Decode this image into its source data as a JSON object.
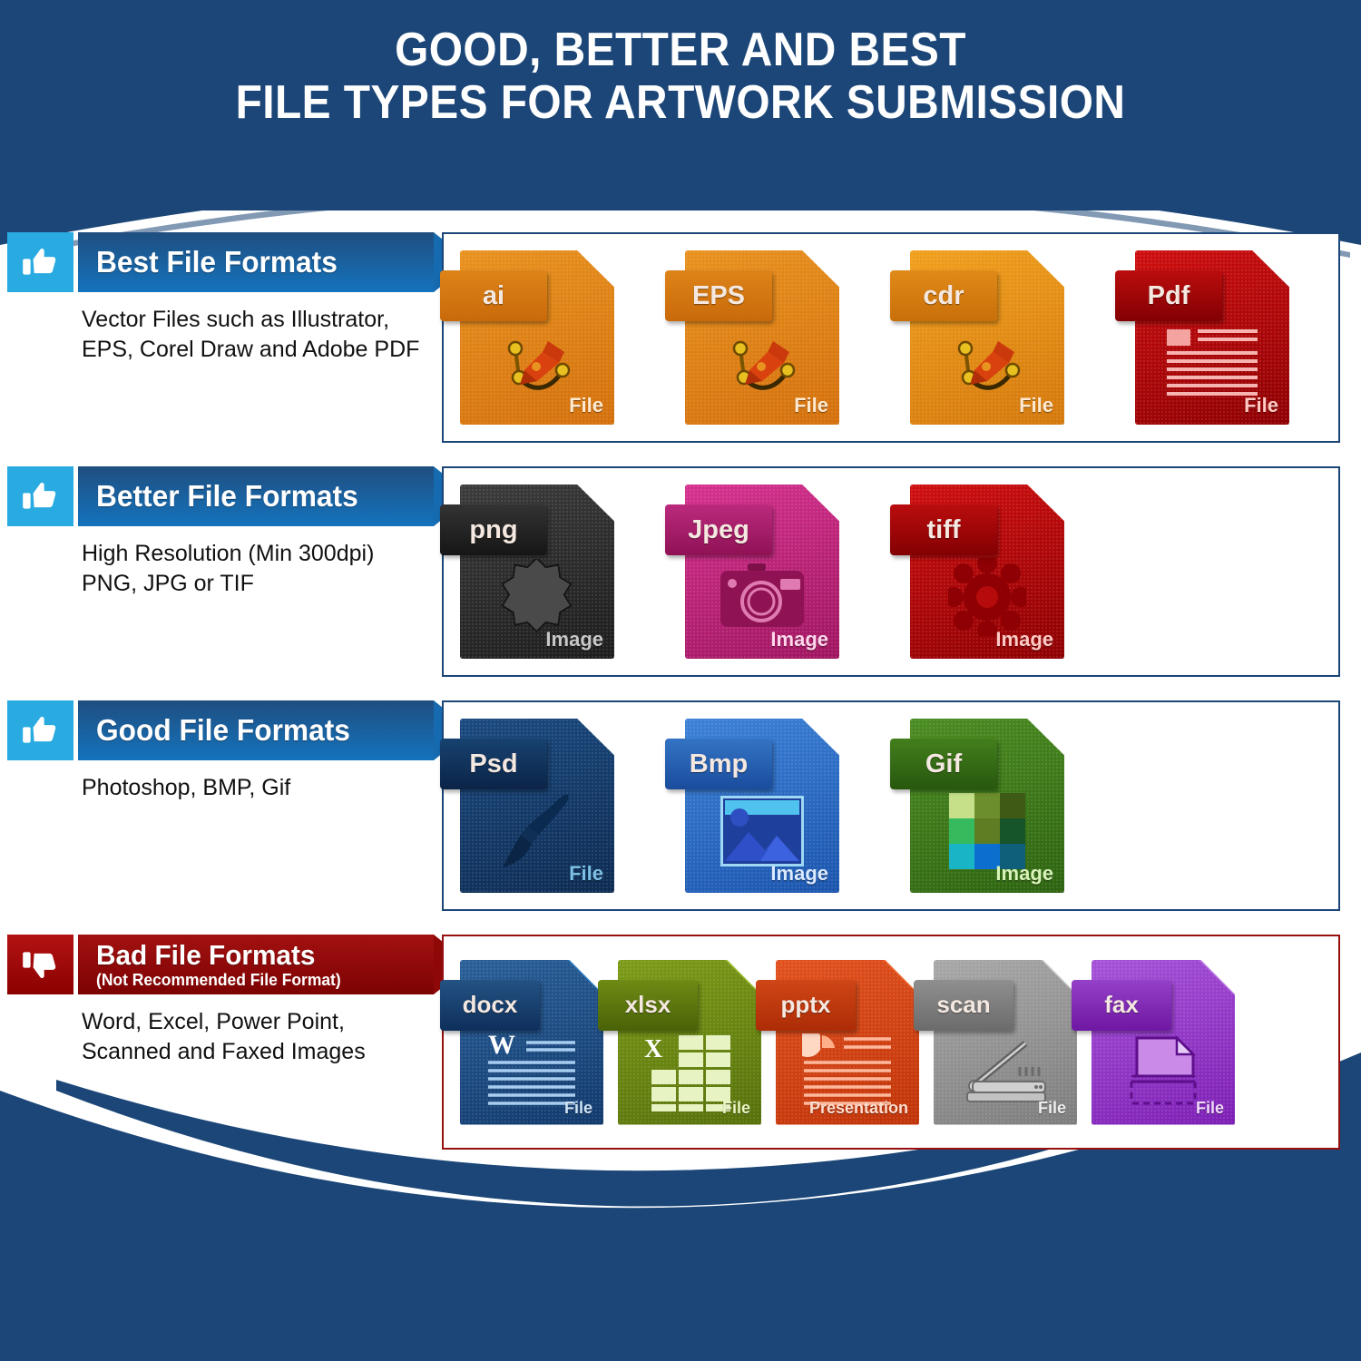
{
  "header": {
    "title_line1": "GOOD, BETTER AND BEST",
    "title_line2": "FILE TYPES FOR ARTWORK SUBMISSION"
  },
  "colors": {
    "brand_navy": "#1b4677",
    "accent_blue": "#29abe2",
    "banner_blue": "#166ab0",
    "bad_red": "#96100f"
  },
  "sections": [
    {
      "id": "best",
      "icon": "thumbs-up-icon",
      "title": "Best File Formats",
      "subtitle": "",
      "description_line1": "Vector Files such as Illustrator,",
      "description_line2": "EPS, Corel Draw and Adobe PDF",
      "files": [
        {
          "label": "ai",
          "kind": "File",
          "glyph": "pen-tool-icon",
          "page_top": "#e8921f",
          "page_bottom": "#d4700c",
          "tag_top": "#dd8419",
          "tag_bottom": "#c96a0a",
          "fold": "#f7d23a",
          "kind_color": "#ffe9cf"
        },
        {
          "label": "EPS",
          "kind": "File",
          "glyph": "pen-tool-icon",
          "page_top": "#e8921f",
          "page_bottom": "#d4700c",
          "tag_top": "#dd8419",
          "tag_bottom": "#c96a0a",
          "fold": "#f7d23a",
          "kind_color": "#ffe9cf"
        },
        {
          "label": "cdr",
          "kind": "File",
          "glyph": "pen-tool-icon",
          "page_top": "#f0a01d",
          "page_bottom": "#d4780c",
          "tag_top": "#e08a18",
          "tag_bottom": "#c96f0a",
          "fold": "#fbe24a",
          "kind_color": "#ffe9cf"
        },
        {
          "label": "Pdf",
          "kind": "File",
          "glyph": "document-lines-icon",
          "page_top": "#cf0f10",
          "page_bottom": "#8e0003",
          "tag_top": "#ba0d0e",
          "tag_bottom": "#830002",
          "fold": "#e82b23",
          "kind_color": "#ffc9c4"
        }
      ]
    },
    {
      "id": "better",
      "icon": "thumbs-up-icon",
      "title": "Better File Formats",
      "subtitle": "",
      "description_line1": "High Resolution (Min 300dpi)",
      "description_line2": "PNG, JPG or TIF",
      "files": [
        {
          "label": "png",
          "kind": "Image",
          "glyph": "starburst-icon",
          "page_top": "#3c3c3c",
          "page_bottom": "#1d1d1d",
          "tag_top": "#333333",
          "tag_bottom": "#161616",
          "fold": "#d8d8d8",
          "kind_color": "#c8c8c8"
        },
        {
          "label": "Jpeg",
          "kind": "Image",
          "glyph": "camera-icon",
          "page_top": "#d6338f",
          "page_bottom": "#a01560",
          "tag_top": "#bb2a7d",
          "tag_bottom": "#8f1255",
          "fold": "#f59ad0",
          "kind_color": "#ffd6ec"
        },
        {
          "label": "tiff",
          "kind": "Image",
          "glyph": "gear-flower-icon",
          "page_top": "#cf0f10",
          "page_bottom": "#8e0003",
          "tag_top": "#ba0d0e",
          "tag_bottom": "#830002",
          "fold": "#e82b23",
          "kind_color": "#ffc9c4"
        }
      ]
    },
    {
      "id": "good",
      "icon": "thumbs-up-icon",
      "title": "Good File Formats",
      "subtitle": "",
      "description_line1": "Photoshop, BMP, Gif",
      "description_line2": "",
      "files": [
        {
          "label": "Psd",
          "kind": "File",
          "glyph": "paintbrush-icon",
          "page_top": "#1b4a80",
          "page_bottom": "#0d2b52",
          "tag_top": "#174270",
          "tag_bottom": "#0b2447",
          "fold": "#6fa4d8",
          "kind_color": "#7cc0e6"
        },
        {
          "label": "Bmp",
          "kind": "Image",
          "glyph": "picture-icon",
          "page_top": "#3d82d8",
          "page_bottom": "#1b55ad",
          "tag_top": "#3474c4",
          "tag_bottom": "#1a4c9c",
          "fold": "#8fd8f5",
          "kind_color": "#dbeaff"
        },
        {
          "label": "Gif",
          "kind": "Image",
          "glyph": "color-grid-icon",
          "page_top": "#4c8d22",
          "page_bottom": "#2d6310",
          "tag_top": "#437f1d",
          "tag_bottom": "#27570d",
          "fold": "#a6e24a",
          "kind_color": "#d8f3b8"
        }
      ]
    },
    {
      "id": "bad",
      "icon": "thumbs-down-icon",
      "title": "Bad File Formats",
      "subtitle": "(Not Recommended File Format)",
      "description_line1": "Word, Excel, Power Point,",
      "description_line2": "Scanned and Faxed Images",
      "files": [
        {
          "label": "docx",
          "kind": "File",
          "glyph": "word-doc-icon",
          "page_top": "#2a6099",
          "page_bottom": "#11396c",
          "tag_top": "#235283",
          "tag_bottom": "#0e2f5c",
          "fold": "#3aa0ee",
          "kind_color": "#cfe3f7"
        },
        {
          "label": "xlsx",
          "kind": "File",
          "glyph": "spreadsheet-icon",
          "page_top": "#7d9c18",
          "page_bottom": "#56700a",
          "tag_top": "#6e8b14",
          "tag_bottom": "#4a6208",
          "fold": "#cbe85c",
          "kind_color": "#e9f5c3"
        },
        {
          "label": "pptx",
          "kind": "Presentation",
          "glyph": "pie-chart-lines-icon",
          "page_top": "#e2521f",
          "page_bottom": "#c03308",
          "tag_top": "#cf4617",
          "tag_bottom": "#ad2c06",
          "fold": "#fa8a4a",
          "kind_color": "#ffded0"
        },
        {
          "label": "scan",
          "kind": "File",
          "glyph": "scanner-icon",
          "page_top": "#a8a8a8",
          "page_bottom": "#7d7d7d",
          "tag_top": "#8f8f8f",
          "tag_bottom": "#6b6b6b",
          "fold": "#ececec",
          "kind_color": "#efefef"
        },
        {
          "label": "fax",
          "kind": "File",
          "glyph": "fax-page-icon",
          "page_top": "#a653d8",
          "page_bottom": "#7d1fb5",
          "tag_top": "#9440c8",
          "tag_bottom": "#6f17a3",
          "fold": "#d9a6f2",
          "kind_color": "#f0d9fb"
        }
      ]
    }
  ]
}
